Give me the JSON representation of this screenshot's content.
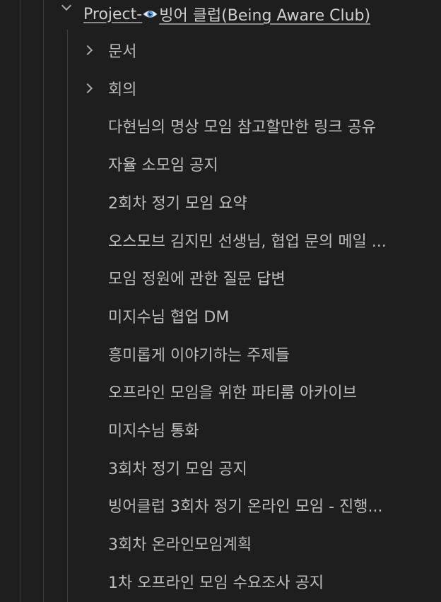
{
  "tree": {
    "root": {
      "label_prefix": "Project-",
      "label_suffix": "빙어 클럽(Being Aware Club)",
      "icon": "eye-icon",
      "expanded": true
    },
    "children": [
      {
        "label": "문서",
        "expandable": true
      },
      {
        "label": "회의",
        "expandable": true
      },
      {
        "label": "다현님의 명상 모임 참고할만한 링크 공유",
        "expandable": false
      },
      {
        "label": "자율 소모임 공지",
        "expandable": false
      },
      {
        "label": "2회차 정기 모임 요약",
        "expandable": false
      },
      {
        "label": "오스모브 김지민 선생님, 협업 문의 메일 ...",
        "expandable": false
      },
      {
        "label": "모임 정원에 관한 질문 답변",
        "expandable": false
      },
      {
        "label": "미지수님 협업 DM",
        "expandable": false
      },
      {
        "label": "흥미롭게 이야기하는 주제들",
        "expandable": false
      },
      {
        "label": "오프라인 모임을 위한 파티룸 아카이브",
        "expandable": false
      },
      {
        "label": "미지수님 통화",
        "expandable": false
      },
      {
        "label": "3회차 정기 모임 공지",
        "expandable": false
      },
      {
        "label": "빙어클럽 3회차 정기 온라인 모임 - 진행...",
        "expandable": false
      },
      {
        "label": "3회차 온라인모임계획",
        "expandable": false
      },
      {
        "label": "1차 오프라인 모임 수요조사 공지",
        "expandable": false
      }
    ]
  },
  "colors": {
    "background": "#1e1e1e",
    "text": "#bdbdbd",
    "guide_line": "#3e3e3e",
    "eye_icon": "#4a90d9"
  }
}
